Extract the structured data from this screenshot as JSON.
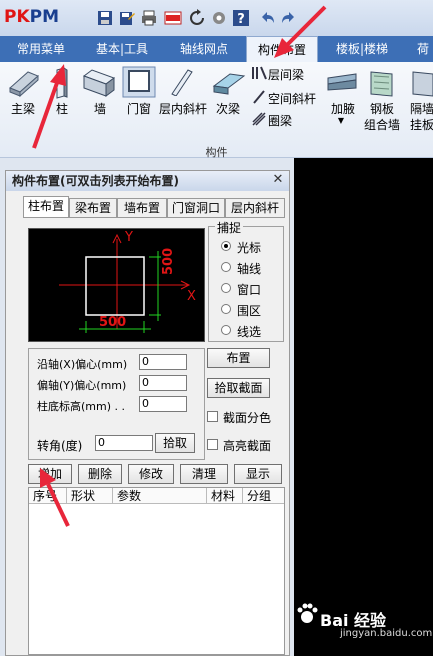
{
  "app": {
    "logo_a": "PK",
    "logo_b": "PM"
  },
  "ribbon_tabs": [
    {
      "label": "常用菜单"
    },
    {
      "label": "基本|工具"
    },
    {
      "label": "轴线网点"
    },
    {
      "label": "构件布置",
      "active": true
    },
    {
      "label": "楼板|楼梯"
    },
    {
      "label": "荷"
    }
  ],
  "ribbon": {
    "buttons": {
      "beam": "主梁",
      "column": "柱",
      "wall": "墙",
      "door_window": "门窗",
      "brace": "层内斜杆",
      "secondary_beam": "次梁",
      "interstory_beam": "层间梁",
      "space_brace": "空间斜杆",
      "ring_beam": "圈梁",
      "haunch": "加腋",
      "steel_slab_1": "钢板",
      "steel_slab_2": "组合墙",
      "partition_1": "隔墙",
      "partition_2": "挂板"
    },
    "group_label": "构件"
  },
  "panel": {
    "title": "构件布置(可双击列表开始布置)",
    "tabs": [
      "柱布置",
      "梁布置",
      "墙布置",
      "门窗洞口",
      "层内斜杆"
    ],
    "preview": {
      "axis_y": "Y",
      "axis_x": "X",
      "dim_width": "500",
      "dim_height": "500"
    },
    "snap": {
      "legend": "捕捉",
      "options": [
        {
          "label": "光标",
          "selected": true
        },
        {
          "label": "轴线",
          "selected": false
        },
        {
          "label": "窗口",
          "selected": false
        },
        {
          "label": "围区",
          "selected": false
        },
        {
          "label": "线选",
          "selected": false
        }
      ]
    },
    "params": {
      "x_offset_label": "沿轴(X)偏心(mm)",
      "x_offset_value": "0",
      "y_offset_label": "偏轴(Y)偏心(mm)",
      "y_offset_value": "0",
      "base_elev_label": "柱底标高(mm) . .",
      "base_elev_value": "0",
      "angle_label": "转角(度)",
      "angle_value": "0",
      "pick_button": "拾取"
    },
    "side_buttons": {
      "place": "布置",
      "pick_section": "拾取截面"
    },
    "checkboxes": {
      "section_color": "截面分色",
      "highlight_section": "高亮截面"
    },
    "action_buttons": [
      "增加",
      "删除",
      "修改",
      "清理",
      "显示"
    ],
    "list_columns": [
      "序号",
      "形状",
      "参数",
      "材料",
      "分组"
    ]
  },
  "watermark": {
    "brand": "Bai 经验",
    "site": "jingyan.baidu.com"
  },
  "colors": {
    "tab_bar": "#3d6fb6",
    "annotation_arrow": "#e8263a",
    "preview_bg": "#000000",
    "dimension": "#22d422",
    "axis": "#e01515"
  }
}
